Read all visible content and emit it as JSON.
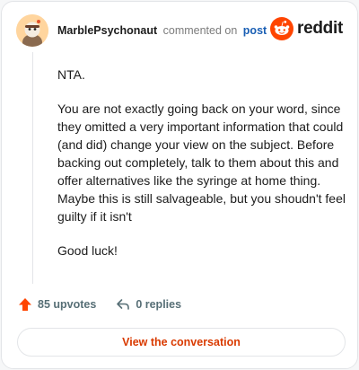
{
  "header": {
    "username": "MarblePsychonaut",
    "action": "commented on",
    "post_link": "post",
    "logo_text": "reddit",
    "avatar": "snoo-avatar-icon"
  },
  "comment": {
    "paragraphs": [
      "NTA.",
      "You are not exactly going back on your word, since they omitted a very important information that could (and did) change your view on the subject. Before backing out completely, talk to them about this and offer alternatives like the syringe at home thing. Maybe this is still salvageable, but you shoudn't feel guilty if it isn't",
      "Good luck!"
    ]
  },
  "actions": {
    "upvotes": "85 upvotes",
    "replies": "0 replies"
  },
  "cta": {
    "label": "View the conversation"
  },
  "colors": {
    "upvote": "#ff4500",
    "cta_text": "#d93a00",
    "link": "#1a5fb4"
  }
}
